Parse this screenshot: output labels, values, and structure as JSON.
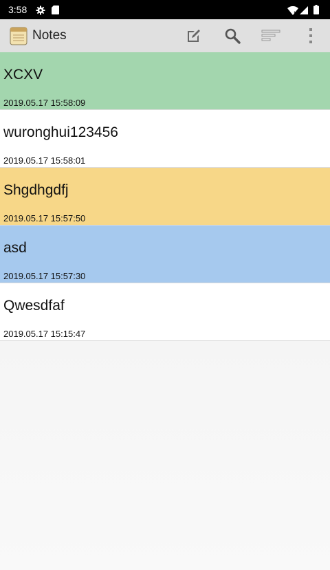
{
  "status_bar": {
    "time": "3:58",
    "icons": [
      "gear-icon",
      "sd-card-icon",
      "wifi-icon",
      "signal-icon",
      "battery-icon"
    ]
  },
  "app_bar": {
    "title": "Notes",
    "logo_icon": "notepad-icon",
    "actions": [
      "new-note-icon",
      "search-icon",
      "sort-icon",
      "more-vert-icon"
    ],
    "background": "#e0e0e0"
  },
  "notes": [
    {
      "title": "XCXV",
      "date": "2019.05.17 15:58:09",
      "color": "#a3d6ae"
    },
    {
      "title": "wuronghui123456",
      "date": "2019.05.17 15:58:01",
      "color": "#ffffff"
    },
    {
      "title": "Shgdhgdfj",
      "date": "2019.05.17 15:57:50",
      "color": "#f7d788"
    },
    {
      "title": "asd",
      "date": "2019.05.17 15:57:30",
      "color": "#a6c9ee"
    },
    {
      "title": "Qwesdfaf",
      "date": "2019.05.17 15:15:47",
      "color": "#ffffff"
    }
  ]
}
